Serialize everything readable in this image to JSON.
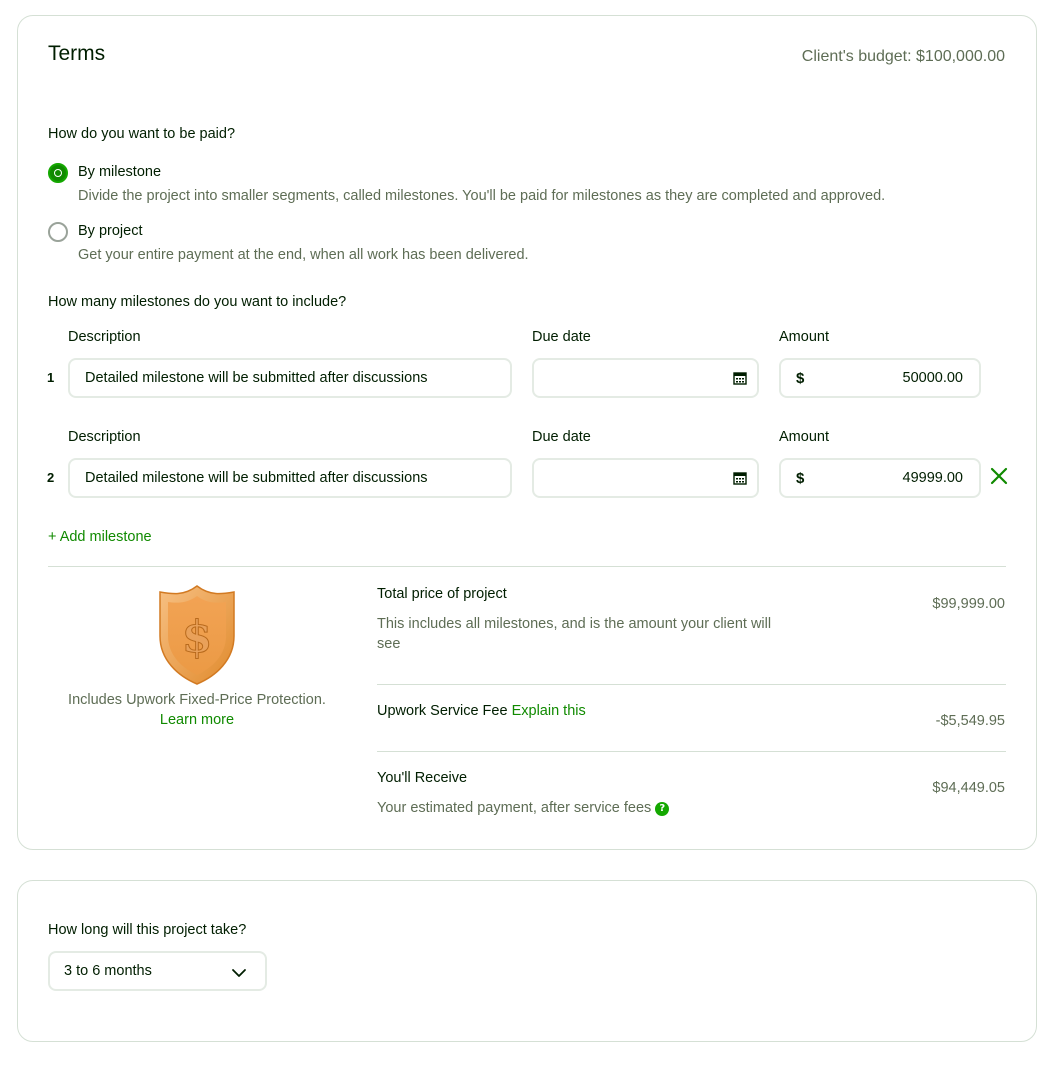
{
  "terms": {
    "title": "Terms",
    "budget_label": "Client's budget: $100,000.00"
  },
  "payment": {
    "question": "How do you want to be paid?",
    "options": [
      {
        "label": "By milestone",
        "description": "Divide the project into smaller segments, called milestones. You'll be paid for milestones as they are completed and approved.",
        "selected": true
      },
      {
        "label": "By project",
        "description": "Get your entire payment at the end, when all work has been delivered.",
        "selected": false
      }
    ]
  },
  "milestones": {
    "question": "How many milestones do you want to include?",
    "col_description": "Description",
    "col_due_date": "Due date",
    "col_amount": "Amount",
    "currency_symbol": "$",
    "rows": [
      {
        "number": "1",
        "description": "Detailed milestone will be submitted after discussions",
        "due_date": "",
        "amount": "50000.00"
      },
      {
        "number": "2",
        "description": "Detailed milestone will be submitted after discussions",
        "due_date": "",
        "amount": "49999.00"
      }
    ],
    "add_label": "+ Add milestone"
  },
  "protection": {
    "text": "Includes Upwork Fixed-Price Protection.",
    "learn_more": "Learn more"
  },
  "pricing": {
    "total_label": "Total price of project",
    "total_sub": "This includes all milestones, and is the amount your client will see",
    "total_value": "$99,999.00",
    "fee_label": "Upwork Service Fee",
    "fee_link": "Explain this",
    "fee_value": "-$5,549.95",
    "receive_label": "You'll Receive",
    "receive_sub": "Your estimated payment, after service fees",
    "receive_value": "$94,449.05"
  },
  "duration": {
    "question": "How long will this project take?",
    "selected": "3 to 6 months"
  },
  "colors": {
    "accent": "#108a00",
    "border": "#d5e0d5",
    "muted_text": "#5e6d55",
    "text": "#001e00"
  },
  "icons": {
    "calendar": "calendar-icon",
    "remove": "close-icon",
    "chevron": "chevron-down-icon",
    "help": "help-icon",
    "shield": "shield-dollar-icon"
  }
}
